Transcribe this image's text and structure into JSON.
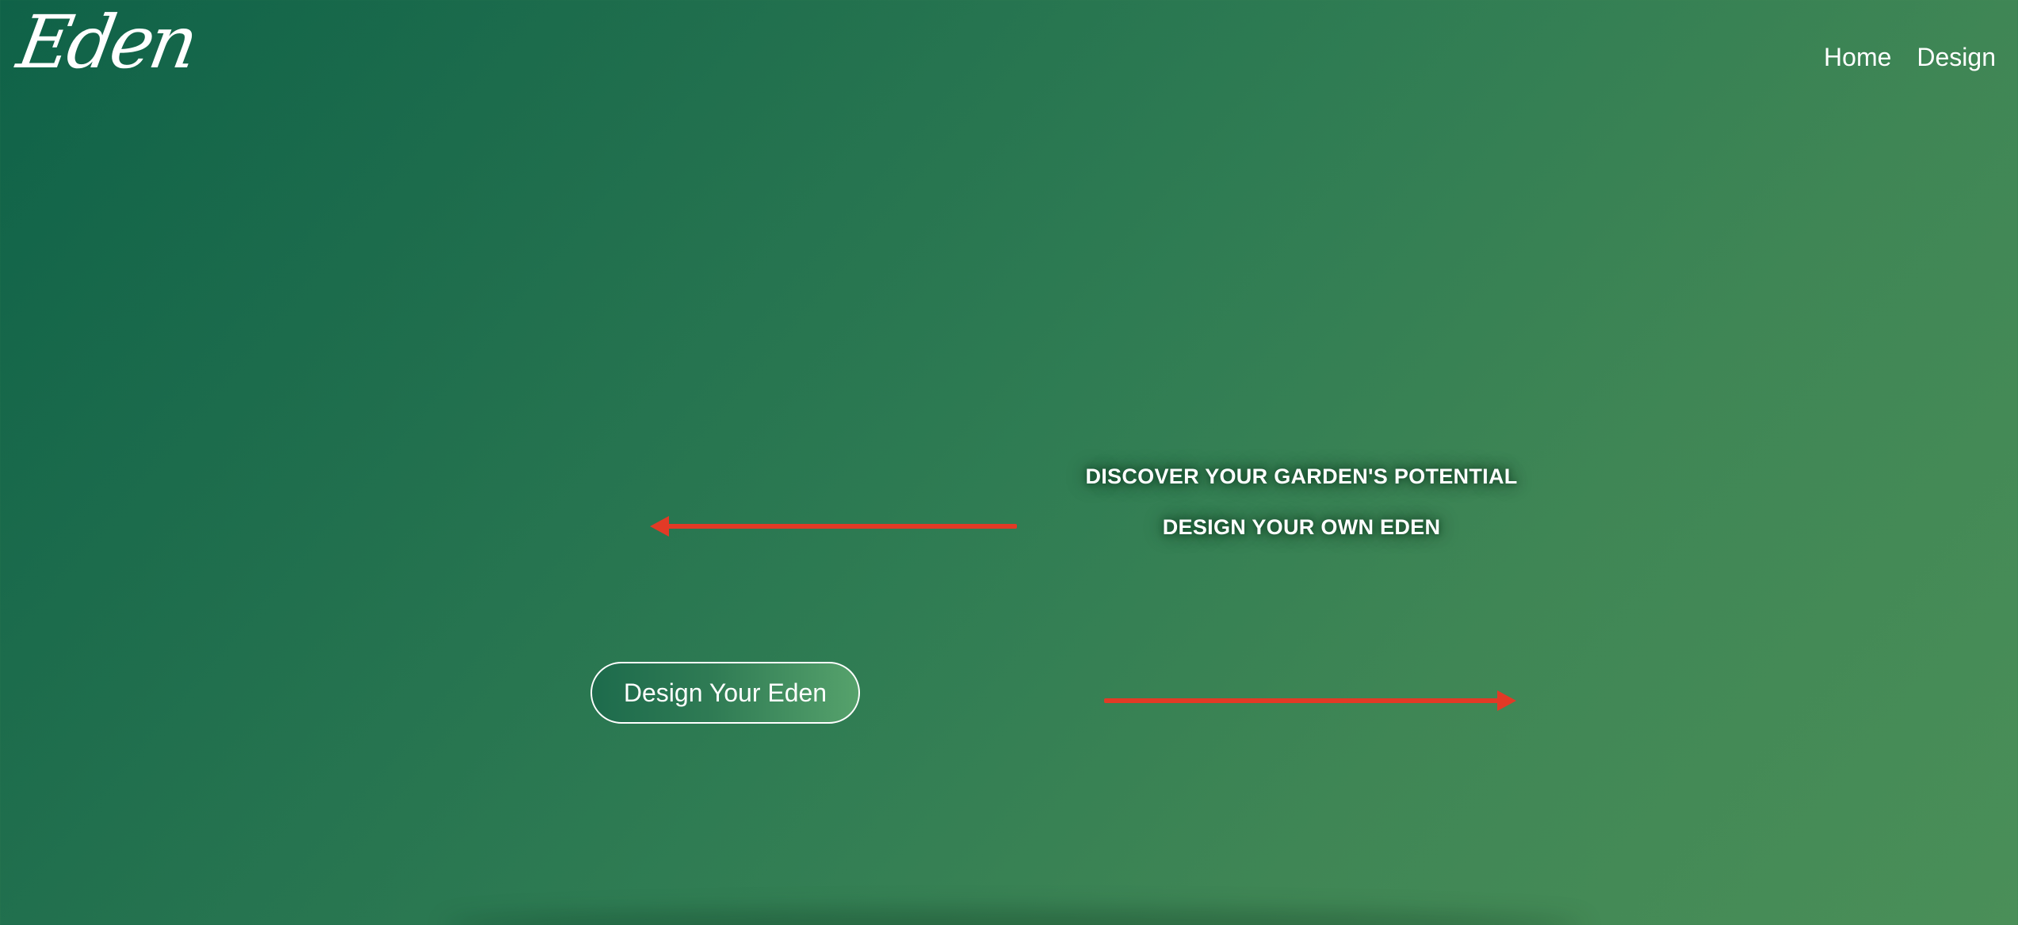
{
  "header": {
    "logo_text": "Eden",
    "nav": [
      {
        "label": "Home"
      },
      {
        "label": "Design"
      }
    ]
  },
  "hero": {
    "line1": "DISCOVER YOUR GARDEN'S POTENTIAL",
    "line2": "DESIGN YOUR OWN EDEN",
    "cta_label": "Design Your Eden"
  },
  "annotations": {
    "arrow_color": "#e23a26",
    "arrows": [
      {
        "icon": "arrow-left-icon",
        "direction": "left"
      },
      {
        "icon": "arrow-right-icon",
        "direction": "right"
      }
    ]
  },
  "colors": {
    "background_start": "#0f6248",
    "background_end": "#4a8f58",
    "text": "#ffffff"
  }
}
